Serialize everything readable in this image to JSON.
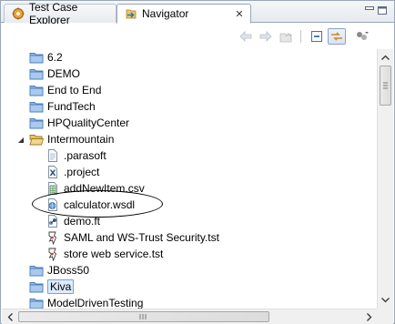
{
  "tabs": [
    {
      "label": "Test Case Explorer",
      "icon": "test-case-explorer-icon",
      "active": false
    },
    {
      "label": "Navigator",
      "icon": "navigator-icon",
      "active": true,
      "close": "✕"
    }
  ],
  "toolbar": [
    {
      "name": "back-arrow-icon",
      "enabled": false
    },
    {
      "name": "forward-arrow-icon",
      "enabled": false
    },
    {
      "name": "up-folder-icon",
      "enabled": false
    },
    {
      "name": "collapse-all-icon",
      "enabled": true
    },
    {
      "name": "link-with-editor-icon",
      "enabled": true,
      "active": true
    },
    {
      "name": "view-menu-icon",
      "enabled": true
    }
  ],
  "tree": [
    {
      "label": "6.2",
      "type": "folder",
      "depth": 0
    },
    {
      "label": "DEMO",
      "type": "folder",
      "depth": 0
    },
    {
      "label": "End to End",
      "type": "folder",
      "depth": 0
    },
    {
      "label": "FundTech",
      "type": "folder",
      "depth": 0
    },
    {
      "label": "HPQualityCenter",
      "type": "folder",
      "depth": 0
    },
    {
      "label": "Intermountain",
      "type": "folder-open",
      "depth": 0,
      "expanded": true
    },
    {
      "label": ".parasoft",
      "type": "file-text",
      "depth": 1
    },
    {
      "label": ".project",
      "type": "file-xml",
      "depth": 1
    },
    {
      "label": "addNewItem.csv",
      "type": "file-csv",
      "depth": 1
    },
    {
      "label": "calculator.wsdl",
      "type": "file-wsdl",
      "depth": 1
    },
    {
      "label": "demo.ft",
      "type": "file-ft",
      "depth": 1
    },
    {
      "label": "SAML and WS-Trust Security.tst",
      "type": "file-tst",
      "depth": 1
    },
    {
      "label": "store web service.tst",
      "type": "file-tst",
      "depth": 1
    },
    {
      "label": "JBoss50",
      "type": "folder",
      "depth": 0
    },
    {
      "label": "Kiva",
      "type": "folder",
      "depth": 0,
      "selected": true
    },
    {
      "label": "ModelDrivenTesting",
      "type": "folder",
      "depth": 0
    }
  ],
  "colors": {
    "folder": "#6b9fd8",
    "selection": "#dcecfc",
    "selection_border": "#7da2ce"
  }
}
